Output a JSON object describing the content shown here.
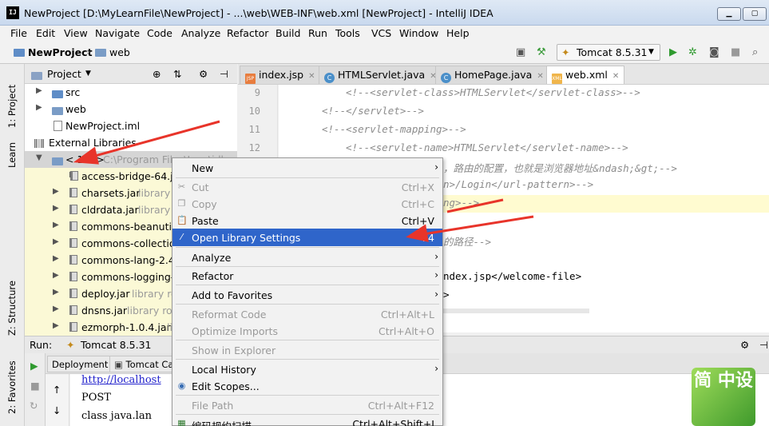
{
  "window": {
    "title": "NewProject [D:\\MyLearnFile\\NewProject] - ...\\web\\WEB-INF\\web.xml [NewProject] - IntelliJ IDEA",
    "app_icon_text": "IJ"
  },
  "menubar": [
    "File",
    "Edit",
    "View",
    "Navigate",
    "Code",
    "Analyze",
    "Refactor",
    "Build",
    "Run",
    "Tools",
    "VCS",
    "Window",
    "Help"
  ],
  "breadcrumb": {
    "project": "NewProject",
    "folder": "web"
  },
  "run_config": {
    "label": "Tomcat 8.5.31"
  },
  "left_strip": {
    "project_tab": "1: Project",
    "learn_tab": "Learn",
    "structure_tab": "Z: Structure",
    "favorites_tab": "2: Favorites"
  },
  "project_panel": {
    "title": "Project",
    "rows": [
      {
        "label": "src",
        "kind": "folder"
      },
      {
        "label": "web",
        "kind": "folder"
      },
      {
        "label": "NewProject.iml",
        "kind": "file"
      },
      {
        "label": "External Libraries",
        "kind": "libs"
      },
      {
        "label": "< 1.8 >",
        "extra": "C:\\Program Files\\Java\\jdk",
        "kind": "sdk"
      },
      {
        "label": "access-bridge-64.jar",
        "extra": "",
        "kind": "jar"
      },
      {
        "label": "charsets.jar",
        "extra": "library",
        "kind": "jar"
      },
      {
        "label": "cldrdata.jar",
        "extra": "library",
        "kind": "jar"
      },
      {
        "label": "commons-beanutils",
        "extra": "",
        "kind": "jar"
      },
      {
        "label": "commons-collection",
        "extra": "",
        "kind": "jar"
      },
      {
        "label": "commons-lang-2.4.",
        "extra": "",
        "kind": "jar"
      },
      {
        "label": "commons-logging-",
        "extra": "",
        "kind": "jar"
      },
      {
        "label": "deploy.jar",
        "extra": "library ro",
        "kind": "jar"
      },
      {
        "label": "dnsns.jar",
        "extra": "library ro",
        "kind": "jar"
      },
      {
        "label": "ezmorph-1.0.4.jar",
        "extra": "li",
        "kind": "jar"
      }
    ]
  },
  "editor_tabs": [
    {
      "label": "index.jsp",
      "icon": "jsp-icon",
      "active": false
    },
    {
      "label": "HTMLServlet.java",
      "icon": "class-icon",
      "active": false
    },
    {
      "label": "HomePage.java",
      "icon": "class-icon",
      "active": false
    },
    {
      "label": "web.xml",
      "icon": "xml-icon",
      "active": true
    }
  ],
  "editor": {
    "line_numbers": [
      "9",
      "10",
      "11",
      "12"
    ],
    "lines": [
      "<!--<servlet-class>HTMLServlet</servlet-class>-->",
      "<!--</servlet>-->",
      "<!--<servlet-mapping>-->",
      "<!--<servlet-name>HTMLServlet</servlet-name>-->",
      "，路由的配置，也就是浏览器地址&ndash;&gt;-->",
      "n>/Login</url-pattern>-->",
      "ng>-->",
      "的路径-->",
      "ndex.jsp</welcome-file>",
      ">"
    ]
  },
  "run_panel": {
    "label": "Run:",
    "config": "Tomcat 8.5.31",
    "tabs": [
      "Deployment",
      "Tomcat Cata"
    ],
    "console": [
      "http://localhost",
      "POST",
      "class java.lan"
    ]
  },
  "context_menu": {
    "items": [
      {
        "label": "New",
        "shortcut": "",
        "submenu": true,
        "disabled": false
      },
      {
        "label": "Cut",
        "shortcut": "Ctrl+X",
        "disabled": true,
        "icon": "cut-icon"
      },
      {
        "label": "Copy",
        "shortcut": "Ctrl+C",
        "disabled": true,
        "icon": "copy-icon"
      },
      {
        "label": "Paste",
        "shortcut": "Ctrl+V",
        "disabled": false,
        "icon": "paste-icon"
      },
      {
        "label": "Open Library Settings",
        "shortcut": "F4",
        "disabled": false,
        "highlighted": true
      },
      {
        "label": "Analyze",
        "submenu": true,
        "disabled": false
      },
      {
        "label": "Refactor",
        "submenu": true,
        "disabled": false
      },
      {
        "label": "Add to Favorites",
        "submenu": true,
        "disabled": false
      },
      {
        "label": "Reformat Code",
        "shortcut": "Ctrl+Alt+L",
        "disabled": true
      },
      {
        "label": "Optimize Imports",
        "shortcut": "Ctrl+Alt+O",
        "disabled": true
      },
      {
        "label": "Show in Explorer",
        "shortcut": "",
        "disabled": true
      },
      {
        "label": "Local History",
        "submenu": true,
        "disabled": false
      },
      {
        "label": "Edit Scopes...",
        "disabled": false,
        "icon": "scopes-icon"
      },
      {
        "label": "File Path",
        "shortcut": "Ctrl+Alt+F12",
        "disabled": true
      },
      {
        "label": "编码规约扫描",
        "shortcut": "Ctrl+Alt+Shift+J",
        "disabled": false
      }
    ]
  },
  "badge": {
    "text": "简 中设"
  },
  "colors": {
    "highlight": "#2f65ca",
    "library_bg": "#fbf9d6",
    "arrow": "#e8342a"
  }
}
